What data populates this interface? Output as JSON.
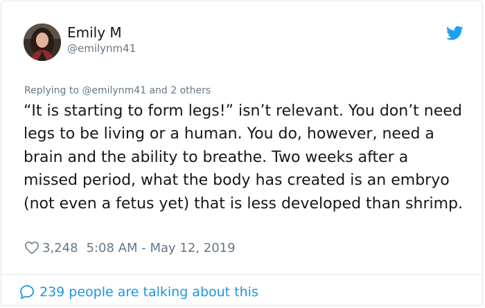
{
  "user": {
    "name": "Emily M",
    "handle": "@emilynm41"
  },
  "reply": {
    "label": "Replying to @emilynm41 and 2 others"
  },
  "tweet": {
    "text": "“It is starting to form legs!” isn’t relevant. You don’t need legs to be living or a human. You do, however, need a brain and the ability to breathe. Two weeks after a missed period, what the body has created is an embryo (not even a fetus yet) that is less developed than shrimp."
  },
  "meta": {
    "likes": "3,248",
    "timestamp": "5:08 AM - May 12, 2019"
  },
  "footer": {
    "talking": "239 people are talking about this"
  },
  "colors": {
    "accent": "#1b95e0",
    "muted": "#657786",
    "text": "#14171a"
  },
  "icons": {
    "brand": "twitter-bird-icon",
    "like": "heart-outline-icon",
    "comment": "speech-bubble-icon"
  }
}
